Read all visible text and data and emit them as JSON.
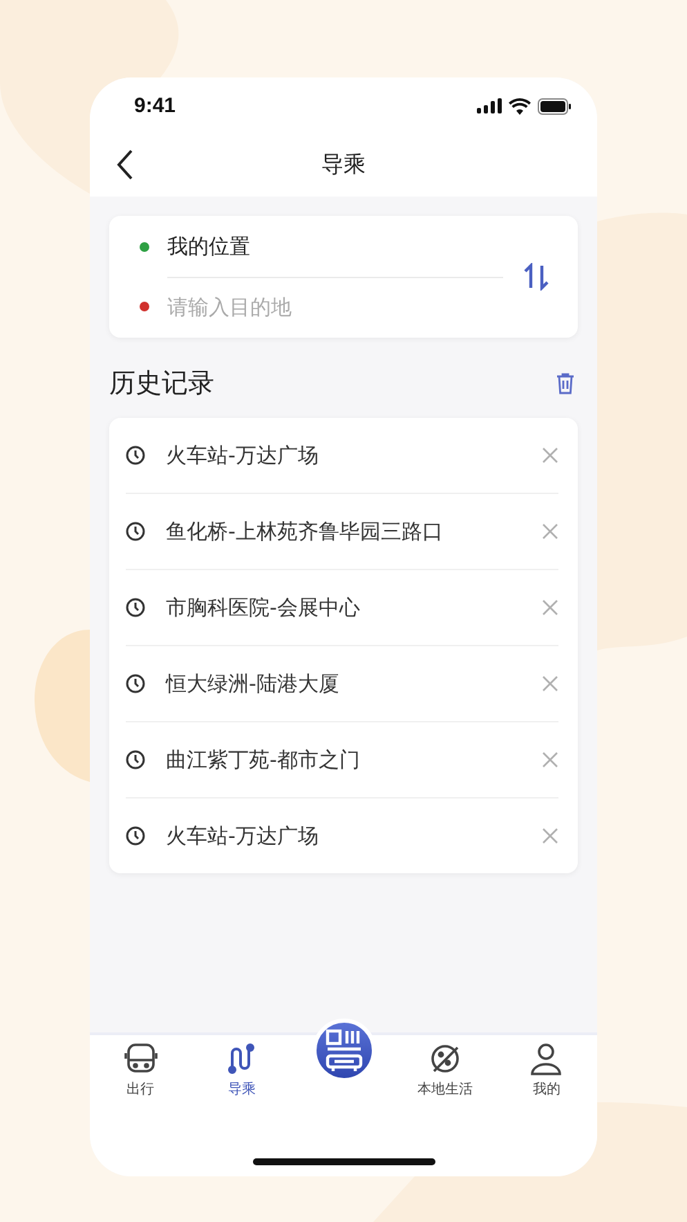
{
  "status_bar": {
    "time": "9:41"
  },
  "nav": {
    "title": "导乘"
  },
  "route": {
    "points": [
      {
        "kind": "value",
        "text": "我的位置",
        "color": "#2ea043"
      },
      {
        "kind": "field",
        "placeholder": "请输入目的地",
        "color": "#d0312d"
      }
    ]
  },
  "history": {
    "title": "历史记录",
    "items": [
      "火车站-万达广场",
      "鱼化桥-上林苑齐鲁毕园三路口",
      "市胸科医院-会展中心",
      "恒大绿洲-陆港大厦",
      "曲江紫丁苑-都市之门",
      "火车站-万达广场"
    ]
  },
  "tabs": [
    {
      "label": "出行",
      "selected": false
    },
    {
      "label": "导乘",
      "selected": true
    },
    {
      "label": "本地生活",
      "selected": false
    },
    {
      "label": "我的",
      "selected": false
    }
  ]
}
